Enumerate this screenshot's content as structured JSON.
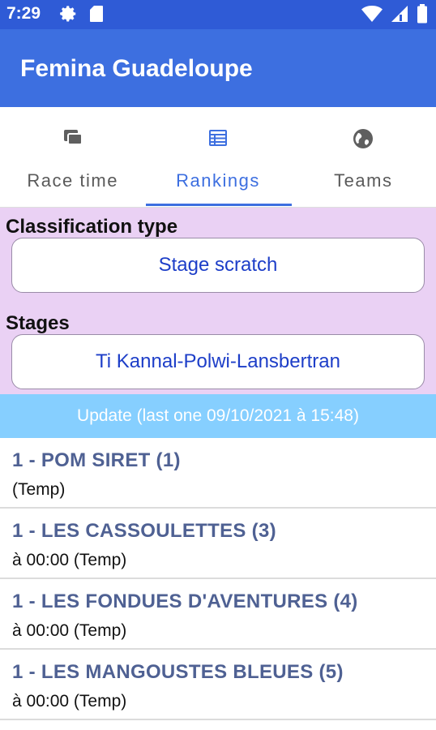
{
  "status_bar": {
    "time": "7:29",
    "icons_left": [
      "gear-icon",
      "sd-card-icon"
    ],
    "icons_right": [
      "wifi-icon",
      "signal-icon",
      "battery-icon"
    ]
  },
  "app_bar": {
    "title": "Femina Guadeloupe"
  },
  "tabs": [
    {
      "label": "Race time",
      "icon": "laptop-icon",
      "active": false
    },
    {
      "label": "Rankings",
      "icon": "table-icon",
      "active": true
    },
    {
      "label": "Teams",
      "icon": "globe-icon",
      "active": false
    }
  ],
  "filters": {
    "classification_label": "Classification type",
    "classification_value": "Stage scratch",
    "stages_label": "Stages",
    "stages_value": "Ti Kannal-Polwi-Lansbertran"
  },
  "update_text": "Update (last one 09/10/2021 à 15:48)",
  "rankings": [
    {
      "title": "1 - POM SIRET (1)",
      "subtitle": " (Temp)"
    },
    {
      "title": "1 - LES CASSOULETTES (3)",
      "subtitle": "à 00:00 (Temp)"
    },
    {
      "title": "1 - LES FONDUES D'AVENTURES (4)",
      "subtitle": "à 00:00 (Temp)"
    },
    {
      "title": "1 - LES MANGOUSTES BLEUES (5)",
      "subtitle": "à 00:00 (Temp)"
    }
  ],
  "colors": {
    "status_bar": "#2f5bd6",
    "app_bar": "#3d6fe0",
    "filters_bg": "#ead1f4",
    "update_bar": "#86cfff",
    "item_title": "#4f6193"
  }
}
